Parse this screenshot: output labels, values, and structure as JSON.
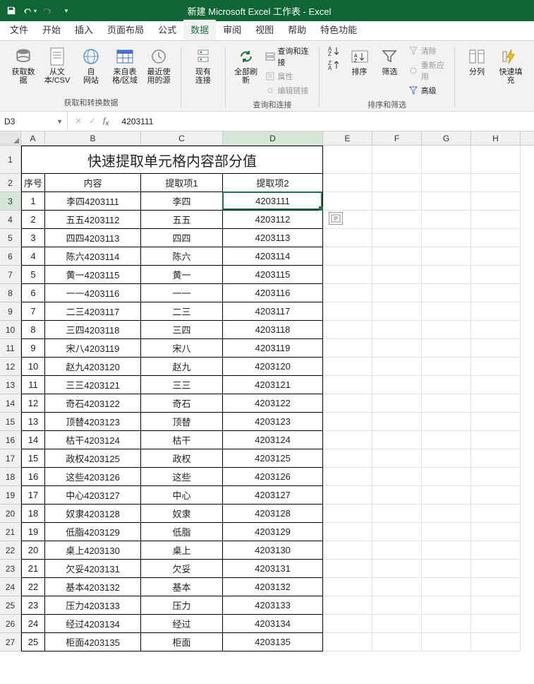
{
  "title": "新建 Microsoft Excel 工作表  -  Excel",
  "nameBox": "D3",
  "formulaValue": "4203111",
  "tabs": [
    "文件",
    "开始",
    "插入",
    "页面布局",
    "公式",
    "数据",
    "审阅",
    "视图",
    "帮助",
    "特色功能"
  ],
  "activeTab": "数据",
  "ribbon": {
    "group1Label": "获取和转换数据",
    "data_get": "获取数\n据",
    "from_csv": "从文\n本/CSV",
    "from_web": "自\n网站",
    "from_table": "来自表\n格/区域",
    "recent": "最近使\n用的源",
    "existing": "现有\n连接",
    "group2Label": "查询和连接",
    "refresh_all": "全部刷新",
    "queries": "查询和连接",
    "props": "属性",
    "edit_links": "编辑链接",
    "group3Label": "排序和筛选",
    "sort": "排序",
    "filter": "筛选",
    "clear": "清除",
    "reapply": "重新应用",
    "advanced": "高级",
    "text_cols": "分列",
    "flash_fill": "快速填充"
  },
  "columns": [
    "A",
    "B",
    "C",
    "D",
    "E",
    "F",
    "G",
    "H"
  ],
  "activeCol": "D",
  "activeRow": 3,
  "sheetTitle": "快速提取单元格内容部分值",
  "headers": {
    "seq": "序号",
    "content": "内容",
    "ext1": "提取项1",
    "ext2": "提取项2"
  },
  "rows": [
    {
      "n": "1",
      "c": "李四4203111",
      "e1": "李四",
      "e2": "4203111"
    },
    {
      "n": "2",
      "c": "五五4203112",
      "e1": "五五",
      "e2": "4203112"
    },
    {
      "n": "3",
      "c": "四四4203113",
      "e1": "四四",
      "e2": "4203113"
    },
    {
      "n": "4",
      "c": "陈六4203114",
      "e1": "陈六",
      "e2": "4203114"
    },
    {
      "n": "5",
      "c": "黄一4203115",
      "e1": "黄一",
      "e2": "4203115"
    },
    {
      "n": "6",
      "c": "一一4203116",
      "e1": "一一",
      "e2": "4203116"
    },
    {
      "n": "7",
      "c": "二三4203117",
      "e1": "二三",
      "e2": "4203117"
    },
    {
      "n": "8",
      "c": "三四4203118",
      "e1": "三四",
      "e2": "4203118"
    },
    {
      "n": "9",
      "c": "宋八4203119",
      "e1": "宋八",
      "e2": "4203119"
    },
    {
      "n": "10",
      "c": "赵九4203120",
      "e1": "赵九",
      "e2": "4203120"
    },
    {
      "n": "11",
      "c": "三三4203121",
      "e1": "三三",
      "e2": "4203121"
    },
    {
      "n": "12",
      "c": "奇石4203122",
      "e1": "奇石",
      "e2": "4203122"
    },
    {
      "n": "13",
      "c": "顶替4203123",
      "e1": "顶替",
      "e2": "4203123"
    },
    {
      "n": "14",
      "c": "枯干4203124",
      "e1": "枯干",
      "e2": "4203124"
    },
    {
      "n": "15",
      "c": "政权4203125",
      "e1": "政权",
      "e2": "4203125"
    },
    {
      "n": "16",
      "c": "这些4203126",
      "e1": "这些",
      "e2": "4203126"
    },
    {
      "n": "17",
      "c": "中心4203127",
      "e1": "中心",
      "e2": "4203127"
    },
    {
      "n": "18",
      "c": "奴隶4203128",
      "e1": "奴隶",
      "e2": "4203128"
    },
    {
      "n": "19",
      "c": "低脂4203129",
      "e1": "低脂",
      "e2": "4203129"
    },
    {
      "n": "20",
      "c": "桌上4203130",
      "e1": "桌上",
      "e2": "4203130"
    },
    {
      "n": "21",
      "c": "欠妥4203131",
      "e1": "欠妥",
      "e2": "4203131"
    },
    {
      "n": "22",
      "c": "基本4203132",
      "e1": "基本",
      "e2": "4203132"
    },
    {
      "n": "23",
      "c": "压力4203133",
      "e1": "压力",
      "e2": "4203133"
    },
    {
      "n": "24",
      "c": "经过4203134",
      "e1": "经过",
      "e2": "4203134"
    },
    {
      "n": "25",
      "c": "柜面4203135",
      "e1": "柜面",
      "e2": "4203135"
    }
  ]
}
